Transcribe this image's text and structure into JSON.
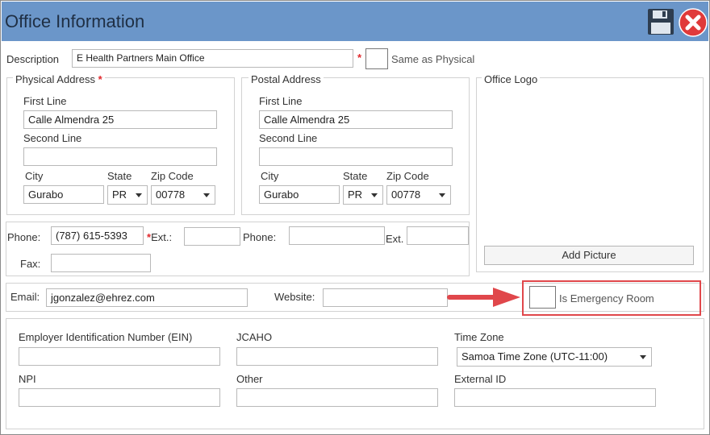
{
  "window": {
    "title": "Office Information"
  },
  "icons": {
    "save": "floppy-disk-icon",
    "close": "close-x-icon"
  },
  "description": {
    "label": "Description",
    "value": "E Health Partners Main Office",
    "required_mark": "*"
  },
  "same_as_physical": {
    "label": "Same as Physical"
  },
  "physical_address": {
    "legend": "Physical Address",
    "required_mark": "*",
    "first_line_label": "First Line",
    "first_line_value": "Calle Almendra 25",
    "second_line_label": "Second Line",
    "second_line_value": "",
    "city_label": "City",
    "city_value": "Gurabo",
    "state_label": "State",
    "state_value": "PR",
    "zip_label": "Zip Code",
    "zip_value": "00778"
  },
  "postal_address": {
    "legend": "Postal Address",
    "first_line_label": "First Line",
    "first_line_value": "Calle Almendra 25",
    "second_line_label": "Second Line",
    "second_line_value": "",
    "city_label": "City",
    "city_value": "Gurabo",
    "state_label": "State",
    "state_value": "PR",
    "zip_label": "Zip Code",
    "zip_value": "00778"
  },
  "office_logo": {
    "legend": "Office Logo",
    "add_picture_label": "Add Picture"
  },
  "phones": {
    "phone_label": "Phone:",
    "phone_value": "(787) 615-5393",
    "required_mark": "*",
    "ext_label": "Ext.:",
    "ext_value": "",
    "phone2_label": "Phone:",
    "phone2_value": "",
    "ext2_label": "Ext.",
    "ext2_value": "",
    "fax_label": "Fax:",
    "fax_value": ""
  },
  "contact": {
    "email_label": "Email:",
    "email_value": "jgonzalez@ehrez.com",
    "website_label": "Website:",
    "website_value": ""
  },
  "emergency": {
    "label": "Is Emergency Room",
    "checked": false
  },
  "annotation": {
    "arrow_color": "#e0474b"
  },
  "ids": {
    "ein_label": "Employer Identification Number (EIN)",
    "ein_value": "",
    "jcaho_label": "JCAHO",
    "jcaho_value": "",
    "timezone_label": "Time Zone",
    "timezone_value": "Samoa Time Zone (UTC-11:00)",
    "npi_label": "NPI",
    "npi_value": "",
    "other_label": "Other",
    "other_value": "",
    "external_id_label": "External ID",
    "external_id_value": ""
  },
  "colors": {
    "titlebar": "#6b96c9",
    "required": "#e0282c",
    "highlight": "#e0474b"
  }
}
